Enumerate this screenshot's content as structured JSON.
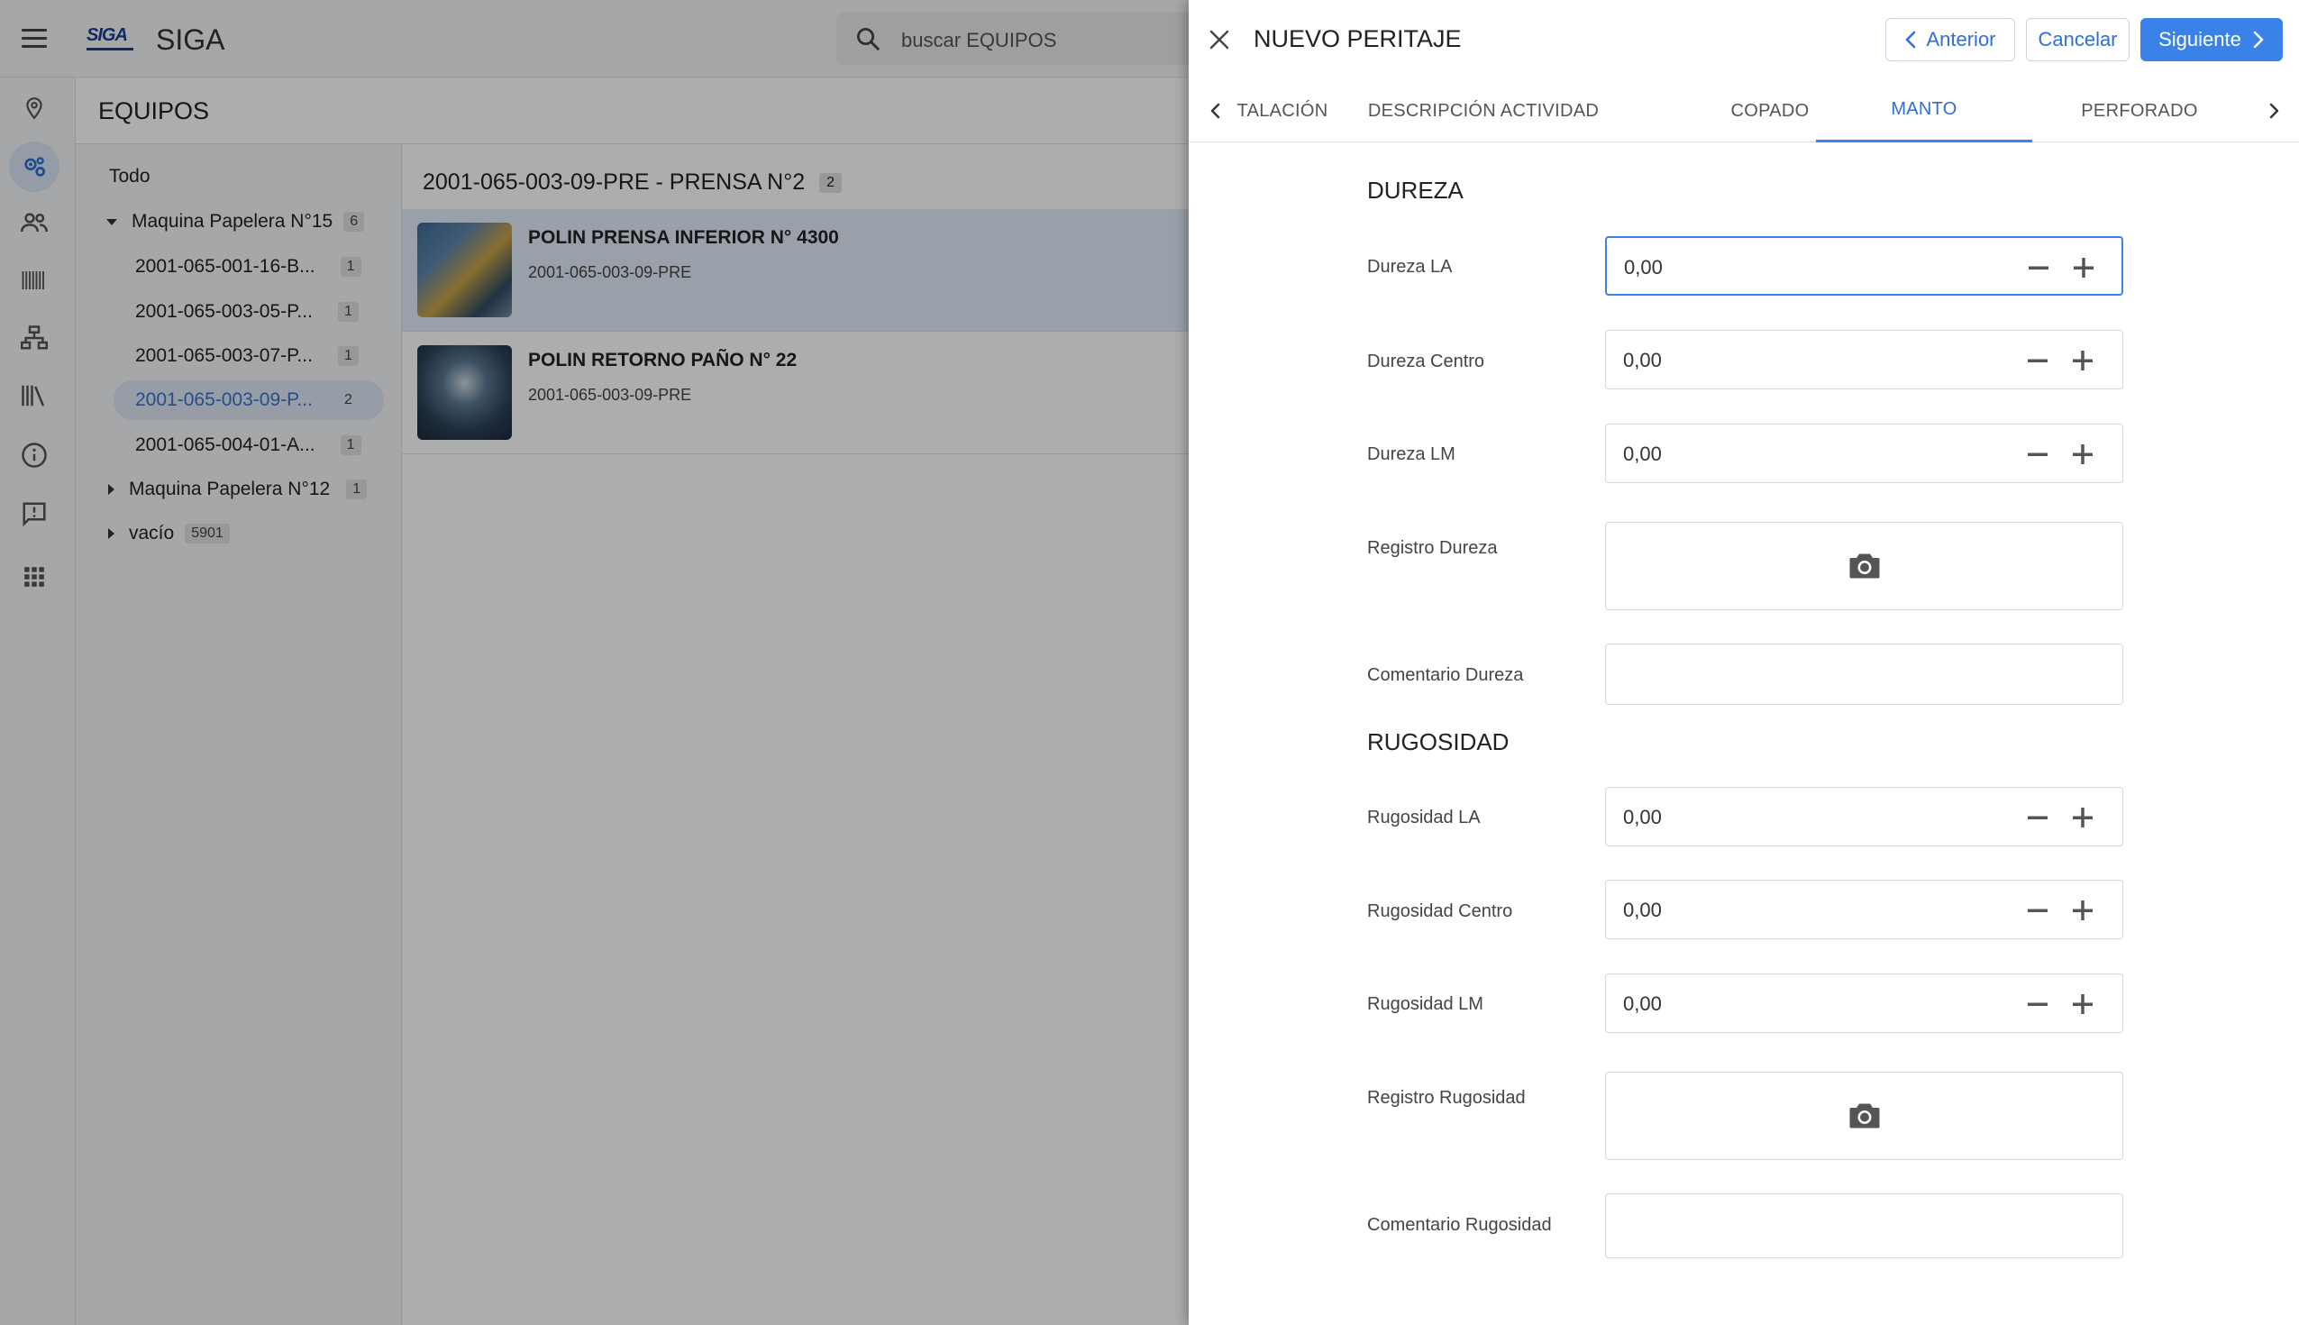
{
  "app": {
    "title": "SIGA",
    "logo_text": "SIGA",
    "search_placeholder": "buscar EQUIPOS"
  },
  "page": {
    "title": "EQUIPOS"
  },
  "tree": {
    "items": [
      {
        "label": "Todo",
        "count": ""
      },
      {
        "label": "Maquina Papelera N°15",
        "count": "6"
      },
      {
        "label": "2001-065-001-16-B...",
        "count": "1"
      },
      {
        "label": "2001-065-003-05-P...",
        "count": "1"
      },
      {
        "label": "2001-065-003-07-P...",
        "count": "1"
      },
      {
        "label": "2001-065-003-09-P...",
        "count": "2"
      },
      {
        "label": "2001-065-004-01-A...",
        "count": "1"
      },
      {
        "label": "Maquina Papelera N°12",
        "count": "1"
      },
      {
        "label": "vacío",
        "count": "5901"
      }
    ]
  },
  "list": {
    "title": "2001-065-003-09-PRE - PRENSA N°2",
    "count": "2",
    "items": [
      {
        "name": "POLIN PRENSA INFERIOR N° 4300",
        "code": "2001-065-003-09-PRE"
      },
      {
        "name": "POLIN RETORNO PAÑO N° 22",
        "code": "2001-065-003-09-PRE"
      }
    ]
  },
  "panel": {
    "title": "NUEVO PERITAJE",
    "prev_label": "Anterior",
    "cancel_label": "Cancelar",
    "next_label": "Siguiente",
    "tabs": [
      "TALACIÓN",
      "DESCRIPCIÓN ACTIVIDAD",
      "COPADO",
      "MANTO",
      "PERFORADO"
    ],
    "active_tab": "MANTO",
    "dureza": {
      "title": "DUREZA",
      "la_label": "Dureza LA",
      "la_value": "0,00",
      "centro_label": "Dureza Centro",
      "centro_value": "0,00",
      "lm_label": "Dureza LM",
      "lm_value": "0,00",
      "registro_label": "Registro Dureza",
      "comentario_label": "Comentario Dureza"
    },
    "rugosidad": {
      "title": "RUGOSIDAD",
      "la_label": "Rugosidad LA",
      "la_value": "0,00",
      "centro_label": "Rugosidad Centro",
      "centro_value": "0,00",
      "lm_label": "Rugosidad LM",
      "lm_value": "0,00",
      "registro_label": "Registro Rugosidad",
      "comentario_label": "Comentario Rugosidad"
    }
  },
  "colors": {
    "accent": "#3b82e8",
    "accent_text": "#2f6fd6",
    "overlay": "rgba(0,0,0,0.32)"
  }
}
